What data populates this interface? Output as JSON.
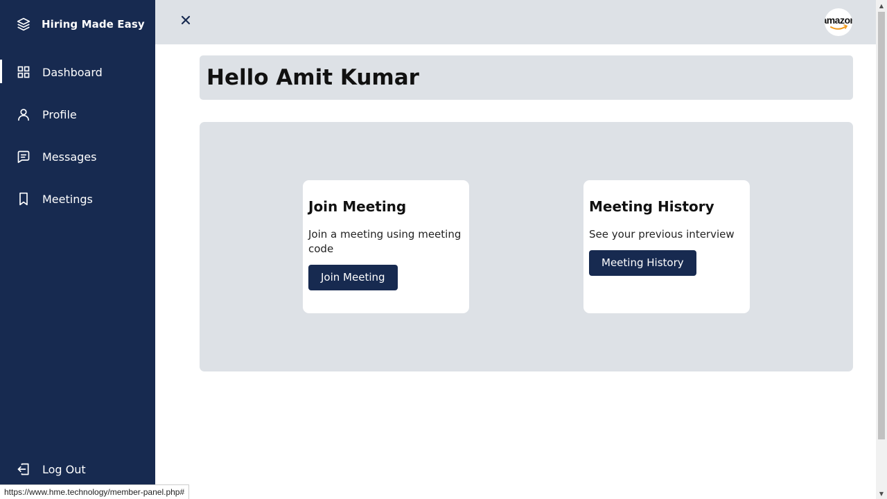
{
  "brand": {
    "name": "Hiring Made Easy",
    "icon": "layers-icon"
  },
  "sidebar": {
    "items": [
      {
        "label": "Dashboard",
        "icon": "grid-icon",
        "active": true
      },
      {
        "label": "Profile",
        "icon": "user-icon",
        "active": false
      },
      {
        "label": "Messages",
        "icon": "message-icon",
        "active": false
      },
      {
        "label": "Meetings",
        "icon": "bookmark-icon",
        "active": false
      }
    ],
    "logout_label": "Log Out"
  },
  "topbar": {
    "close_icon": "close-icon",
    "avatar_text": "amazon"
  },
  "greeting": "Hello Amit Kumar",
  "cards": [
    {
      "title": "Join Meeting",
      "description": "Join a meeting using meeting code",
      "button": "Join Meeting"
    },
    {
      "title": "Meeting History",
      "description": "See your previous interview",
      "button": "Meeting History"
    }
  ],
  "status_url": "https://www.hme.technology/member-panel.php#",
  "colors": {
    "sidebar": "#172a50",
    "panel": "#dde1e6",
    "button": "#172a50"
  }
}
